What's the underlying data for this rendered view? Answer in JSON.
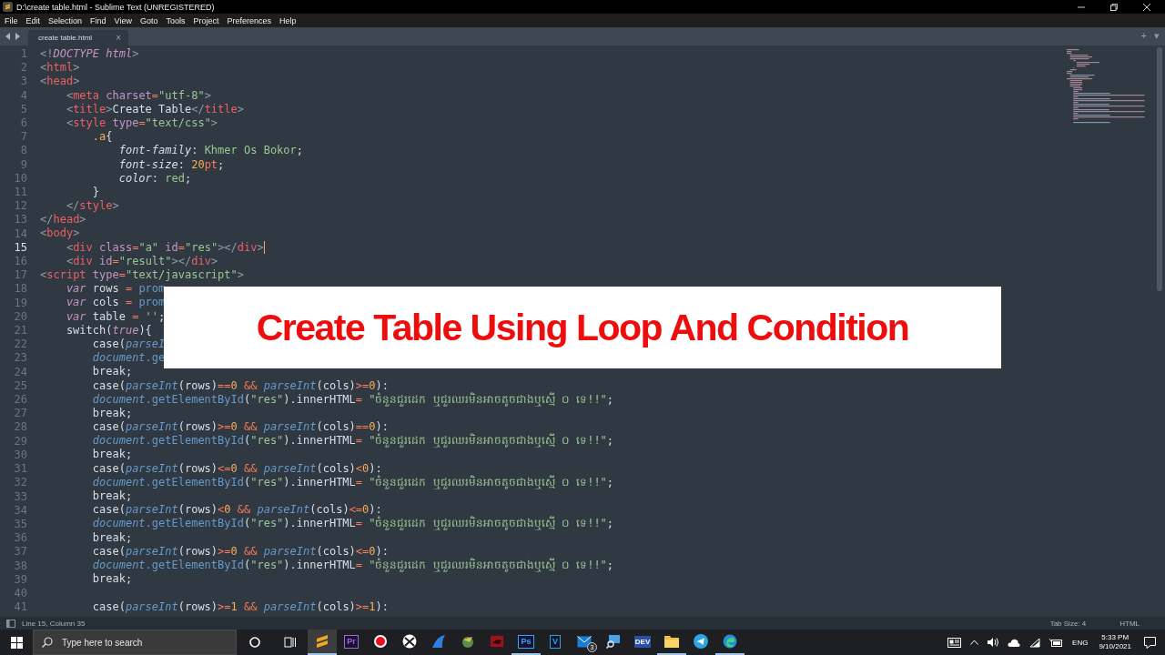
{
  "window": {
    "title": "D:\\create table.html - Sublime Text (UNREGISTERED)"
  },
  "menu": [
    "File",
    "Edit",
    "Selection",
    "Find",
    "View",
    "Goto",
    "Tools",
    "Project",
    "Preferences",
    "Help"
  ],
  "tabs": [
    {
      "label": "create table.html",
      "close": "×",
      "selected": true
    }
  ],
  "tab_bar_actions": {
    "new": "+",
    "list": "▾"
  },
  "editor": {
    "lines": [
      {
        "number": "1",
        "current": false,
        "tokens": [
          {
            "text": "<!",
            "kind": "pu"
          },
          {
            "text": "DOCTYPE html",
            "kind": "em"
          },
          {
            "text": ">",
            "kind": "pu"
          }
        ]
      },
      {
        "number": "2",
        "current": false,
        "tokens": [
          {
            "text": "<",
            "kind": "pu"
          },
          {
            "text": "html",
            "kind": "tag"
          },
          {
            "text": ">",
            "kind": "pu"
          }
        ]
      },
      {
        "number": "3",
        "current": false,
        "tokens": [
          {
            "text": "<",
            "kind": "pu"
          },
          {
            "text": "head",
            "kind": "tag"
          },
          {
            "text": ">",
            "kind": "pu"
          }
        ],
        "children": [
          {
            "number": "4",
            "current": false,
            "tokens": [
              {
                "text": "<",
                "kind": "pu"
              },
              {
                "text": "meta",
                "kind": "tag"
              },
              {
                "text": " charset",
                "kind": "attr"
              },
              {
                "text": "=",
                "kind": "op"
              },
              {
                "text": "\"utf-8\"",
                "kind": "str"
              },
              {
                "text": ">",
                "kind": "pu"
              }
            ]
          },
          {
            "number": "5",
            "current": false,
            "tokens": [
              {
                "text": "<",
                "kind": "pu"
              },
              {
                "text": "title",
                "kind": "tag"
              },
              {
                "text": ">",
                "kind": "pu"
              },
              {
                "text": "Create Table",
                "kind": "tx"
              },
              {
                "text": "</",
                "kind": "pu"
              },
              {
                "text": "title",
                "kind": "tag"
              },
              {
                "text": ">",
                "kind": "pu"
              }
            ]
          },
          {
            "number": "6",
            "current": false,
            "tokens": [
              {
                "text": "<",
                "kind": "pu"
              },
              {
                "text": "style",
                "kind": "tag"
              },
              {
                "text": " type",
                "kind": "attr"
              },
              {
                "text": "=",
                "kind": "op"
              },
              {
                "text": "\"text/css\"",
                "kind": "str"
              },
              {
                "text": ">",
                "kind": "pu"
              }
            ],
            "children": [
              {
                "number": "7",
                "current": false,
                "tokens": [
                  {
                    "text": ".a",
                    "kind": "cls"
                  },
                  {
                    "text": "{",
                    "kind": "tx"
                  }
                ],
                "children": [
                  {
                    "number": "8",
                    "current": false,
                    "tokens": [
                      {
                        "text": "font-family",
                        "kind": "prop"
                      },
                      {
                        "text": ":",
                        "kind": "tx"
                      },
                      {
                        "text": " Khmer Os Bokor",
                        "kind": "str"
                      },
                      {
                        "text": ";",
                        "kind": "tx"
                      }
                    ]
                  },
                  {
                    "number": "9",
                    "current": false,
                    "tokens": [
                      {
                        "text": "font-size",
                        "kind": "prop"
                      },
                      {
                        "text": ":",
                        "kind": "tx"
                      },
                      {
                        "text": " 20",
                        "kind": "num"
                      },
                      {
                        "text": "pt",
                        "kind": "op"
                      },
                      {
                        "text": ";",
                        "kind": "tx"
                      }
                    ]
                  },
                  {
                    "number": "10",
                    "current": false,
                    "tokens": [
                      {
                        "text": "color",
                        "kind": "prop"
                      },
                      {
                        "text": ":",
                        "kind": "tx"
                      },
                      {
                        "text": " red",
                        "kind": "str"
                      },
                      {
                        "text": ";",
                        "kind": "tx"
                      }
                    ]
                  }
                ]
              },
              {
                "number": "11",
                "current": false,
                "tokens": [
                  {
                    "text": "}",
                    "kind": "tx"
                  }
                ]
              }
            ]
          },
          {
            "number": "12",
            "current": false,
            "tokens": [
              {
                "text": "</",
                "kind": "pu"
              },
              {
                "text": "style",
                "kind": "tag"
              },
              {
                "text": ">",
                "kind": "pu"
              }
            ]
          }
        ]
      },
      {
        "number": "13",
        "current": false,
        "tokens": [
          {
            "text": "</",
            "kind": "pu"
          },
          {
            "text": "head",
            "kind": "tag"
          },
          {
            "text": ">",
            "kind": "pu"
          }
        ]
      },
      {
        "number": "14",
        "current": false,
        "tokens": [
          {
            "text": "<",
            "kind": "pu"
          },
          {
            "text": "body",
            "kind": "tag"
          },
          {
            "text": ">",
            "kind": "pu"
          }
        ],
        "children": [
          {
            "number": "15",
            "current": true,
            "tokens": [
              {
                "text": "<",
                "kind": "pu"
              },
              {
                "text": "div",
                "kind": "tag"
              },
              {
                "text": " class",
                "kind": "attr"
              },
              {
                "text": "=",
                "kind": "op"
              },
              {
                "text": "\"a\"",
                "kind": "str"
              },
              {
                "text": " id",
                "kind": "attr"
              },
              {
                "text": "=",
                "kind": "op"
              },
              {
                "text": "\"res\"",
                "kind": "str"
              },
              {
                "text": "></",
                "kind": "pu"
              },
              {
                "text": "div",
                "kind": "tag"
              },
              {
                "text": ">",
                "kind": "pu"
              }
            ]
          },
          {
            "number": "16",
            "current": false,
            "tokens": [
              {
                "text": "<",
                "kind": "pu"
              },
              {
                "text": "div",
                "kind": "tag"
              },
              {
                "text": " id",
                "kind": "attr"
              },
              {
                "text": "=",
                "kind": "op"
              },
              {
                "text": "\"result\"",
                "kind": "str"
              },
              {
                "text": "></",
                "kind": "pu"
              },
              {
                "text": "div",
                "kind": "tag"
              },
              {
                "text": ">",
                "kind": "pu"
              }
            ]
          }
        ]
      },
      {
        "number": "17",
        "current": false,
        "tokens": [
          {
            "text": "<",
            "kind": "pu"
          },
          {
            "text": "script",
            "kind": "tag"
          },
          {
            "text": " type",
            "kind": "attr"
          },
          {
            "text": "=",
            "kind": "op"
          },
          {
            "text": "\"text/javascript\"",
            "kind": "str"
          },
          {
            "text": ">",
            "kind": "pu"
          }
        ],
        "children": [
          {
            "number": "18",
            "current": false,
            "tokens": [
              {
                "text": "var",
                "kind": "kw"
              },
              {
                "text": " rows",
                "kind": "tx"
              },
              {
                "text": " =",
                "kind": "op"
              },
              {
                "text": " prom",
                "kind": "method"
              }
            ]
          },
          {
            "number": "19",
            "current": false,
            "tokens": [
              {
                "text": "var",
                "kind": "kw"
              },
              {
                "text": " cols",
                "kind": "tx"
              },
              {
                "text": " =",
                "kind": "op"
              },
              {
                "text": " prom",
                "kind": "method"
              }
            ]
          },
          {
            "number": "20",
            "current": false,
            "tokens": [
              {
                "text": "var",
                "kind": "kw"
              },
              {
                "text": " table",
                "kind": "tx"
              },
              {
                "text": " =",
                "kind": "op"
              },
              {
                "text": " ''",
                "kind": "str"
              },
              {
                "text": ";",
                "kind": "tx"
              }
            ]
          },
          {
            "number": "21",
            "current": false,
            "tokens": [
              {
                "text": "switch(",
                "kind": "tx"
              },
              {
                "text": "true",
                "kind": "kw"
              },
              {
                "text": "){",
                "kind": "tx"
              }
            ],
            "children": [
              {
                "number": "22",
                "current": false,
                "tokens": [
                  {
                    "text": "case(",
                    "kind": "tx"
                  },
                  {
                    "text": "parseI",
                    "kind": "fn"
                  }
                ]
              },
              {
                "number": "23",
                "current": false,
                "tokens": [
                  {
                    "text": "document",
                    "kind": "fn"
                  },
                  {
                    "text": ".ge",
                    "kind": "method"
                  }
                ]
              },
              {
                "number": "24",
                "current": false,
                "tokens": [
                  {
                    "text": "break;",
                    "kind": "tx"
                  }
                ]
              },
              {
                "number": "25",
                "current": false,
                "tokens": [
                  {
                    "text": "case(",
                    "kind": "tx"
                  },
                  {
                    "text": "parseInt",
                    "kind": "fn"
                  },
                  {
                    "text": "(rows)",
                    "kind": "tx"
                  },
                  {
                    "text": "==",
                    "kind": "op"
                  },
                  {
                    "text": "0",
                    "kind": "num"
                  },
                  {
                    "text": " &&",
                    "kind": "op"
                  },
                  {
                    "text": " parseInt",
                    "kind": "fn"
                  },
                  {
                    "text": "(cols)",
                    "kind": "tx"
                  },
                  {
                    "text": ">=",
                    "kind": "op"
                  },
                  {
                    "text": "0",
                    "kind": "num"
                  },
                  {
                    "text": "):",
                    "kind": "tx"
                  }
                ]
              },
              {
                "number": "26",
                "current": false,
                "tokens": [
                  {
                    "text": "document",
                    "kind": "fn"
                  },
                  {
                    "text": ".getElementById",
                    "kind": "method"
                  },
                  {
                    "text": "(",
                    "kind": "tx"
                  },
                  {
                    "text": "\"res\"",
                    "kind": "str"
                  },
                  {
                    "text": ").innerHTML",
                    "kind": "tx"
                  },
                  {
                    "text": "=",
                    "kind": "op"
                  },
                  {
                    "text": " \"ចំនួនជួរដេក ឬជួរឈរមិនអាចតូចជាងឬស្មើ ០ ទេ!!\"",
                    "kind": "str"
                  },
                  {
                    "text": ";",
                    "kind": "tx"
                  }
                ]
              },
              {
                "number": "27",
                "current": false,
                "tokens": [
                  {
                    "text": "break;",
                    "kind": "tx"
                  }
                ]
              },
              {
                "number": "28",
                "current": false,
                "tokens": [
                  {
                    "text": "case(",
                    "kind": "tx"
                  },
                  {
                    "text": "parseInt",
                    "kind": "fn"
                  },
                  {
                    "text": "(rows)",
                    "kind": "tx"
                  },
                  {
                    "text": ">=",
                    "kind": "op"
                  },
                  {
                    "text": "0",
                    "kind": "num"
                  },
                  {
                    "text": " &&",
                    "kind": "op"
                  },
                  {
                    "text": " parseInt",
                    "kind": "fn"
                  },
                  {
                    "text": "(cols)",
                    "kind": "tx"
                  },
                  {
                    "text": "==",
                    "kind": "op"
                  },
                  {
                    "text": "0",
                    "kind": "num"
                  },
                  {
                    "text": "):",
                    "kind": "tx"
                  }
                ]
              },
              {
                "number": "29",
                "current": false,
                "tokens": [
                  {
                    "text": "document",
                    "kind": "fn"
                  },
                  {
                    "text": ".getElementById",
                    "kind": "method"
                  },
                  {
                    "text": "(",
                    "kind": "tx"
                  },
                  {
                    "text": "\"res\"",
                    "kind": "str"
                  },
                  {
                    "text": ").innerHTML",
                    "kind": "tx"
                  },
                  {
                    "text": "=",
                    "kind": "op"
                  },
                  {
                    "text": " \"ចំនួនជួរដេក ឬជួរឈរមិនអាចតូចជាងឬស្មើ ០ ទេ!!\"",
                    "kind": "str"
                  },
                  {
                    "text": ";",
                    "kind": "tx"
                  }
                ]
              },
              {
                "number": "30",
                "current": false,
                "tokens": [
                  {
                    "text": "break;",
                    "kind": "tx"
                  }
                ]
              },
              {
                "number": "31",
                "current": false,
                "tokens": [
                  {
                    "text": "case(",
                    "kind": "tx"
                  },
                  {
                    "text": "parseInt",
                    "kind": "fn"
                  },
                  {
                    "text": "(rows)",
                    "kind": "tx"
                  },
                  {
                    "text": "<=",
                    "kind": "op"
                  },
                  {
                    "text": "0",
                    "kind": "num"
                  },
                  {
                    "text": " &&",
                    "kind": "op"
                  },
                  {
                    "text": " parseInt",
                    "kind": "fn"
                  },
                  {
                    "text": "(cols)",
                    "kind": "tx"
                  },
                  {
                    "text": "<",
                    "kind": "op"
                  },
                  {
                    "text": "0",
                    "kind": "num"
                  },
                  {
                    "text": "):",
                    "kind": "tx"
                  }
                ]
              },
              {
                "number": "32",
                "current": false,
                "tokens": [
                  {
                    "text": "document",
                    "kind": "fn"
                  },
                  {
                    "text": ".getElementById",
                    "kind": "method"
                  },
                  {
                    "text": "(",
                    "kind": "tx"
                  },
                  {
                    "text": "\"res\"",
                    "kind": "str"
                  },
                  {
                    "text": ").innerHTML",
                    "kind": "tx"
                  },
                  {
                    "text": "=",
                    "kind": "op"
                  },
                  {
                    "text": " \"ចំនួនជួរដេក ឬជួរឈរមិនអាចតូចជាងឬស្មើ ០ ទេ!!\"",
                    "kind": "str"
                  },
                  {
                    "text": ";",
                    "kind": "tx"
                  }
                ]
              },
              {
                "number": "33",
                "current": false,
                "tokens": [
                  {
                    "text": "break;",
                    "kind": "tx"
                  }
                ]
              },
              {
                "number": "34",
                "current": false,
                "tokens": [
                  {
                    "text": "case(",
                    "kind": "tx"
                  },
                  {
                    "text": "parseInt",
                    "kind": "fn"
                  },
                  {
                    "text": "(rows)",
                    "kind": "tx"
                  },
                  {
                    "text": "<",
                    "kind": "op"
                  },
                  {
                    "text": "0",
                    "kind": "num"
                  },
                  {
                    "text": " &&",
                    "kind": "op"
                  },
                  {
                    "text": " parseInt",
                    "kind": "fn"
                  },
                  {
                    "text": "(cols)",
                    "kind": "tx"
                  },
                  {
                    "text": "<=",
                    "kind": "op"
                  },
                  {
                    "text": "0",
                    "kind": "num"
                  },
                  {
                    "text": "):",
                    "kind": "tx"
                  }
                ]
              },
              {
                "number": "35",
                "current": false,
                "tokens": [
                  {
                    "text": "document",
                    "kind": "fn"
                  },
                  {
                    "text": ".getElementById",
                    "kind": "method"
                  },
                  {
                    "text": "(",
                    "kind": "tx"
                  },
                  {
                    "text": "\"res\"",
                    "kind": "str"
                  },
                  {
                    "text": ").innerHTML",
                    "kind": "tx"
                  },
                  {
                    "text": "=",
                    "kind": "op"
                  },
                  {
                    "text": " \"ចំនួនជួរដេក ឬជួរឈរមិនអាចតូចជាងឬស្មើ ០ ទេ!!\"",
                    "kind": "str"
                  },
                  {
                    "text": ";",
                    "kind": "tx"
                  }
                ]
              },
              {
                "number": "36",
                "current": false,
                "tokens": [
                  {
                    "text": "break;",
                    "kind": "tx"
                  }
                ]
              },
              {
                "number": "37",
                "current": false,
                "tokens": [
                  {
                    "text": "case(",
                    "kind": "tx"
                  },
                  {
                    "text": "parseInt",
                    "kind": "fn"
                  },
                  {
                    "text": "(rows)",
                    "kind": "tx"
                  },
                  {
                    "text": ">=",
                    "kind": "op"
                  },
                  {
                    "text": "0",
                    "kind": "num"
                  },
                  {
                    "text": " &&",
                    "kind": "op"
                  },
                  {
                    "text": " parseInt",
                    "kind": "fn"
                  },
                  {
                    "text": "(cols)",
                    "kind": "tx"
                  },
                  {
                    "text": "<=",
                    "kind": "op"
                  },
                  {
                    "text": "0",
                    "kind": "num"
                  },
                  {
                    "text": "):",
                    "kind": "tx"
                  }
                ]
              },
              {
                "number": "38",
                "current": false,
                "tokens": [
                  {
                    "text": "document",
                    "kind": "fn"
                  },
                  {
                    "text": ".getElementById",
                    "kind": "method"
                  },
                  {
                    "text": "(",
                    "kind": "tx"
                  },
                  {
                    "text": "\"res\"",
                    "kind": "str"
                  },
                  {
                    "text": ").innerHTML",
                    "kind": "tx"
                  },
                  {
                    "text": "=",
                    "kind": "op"
                  },
                  {
                    "text": " \"ចំនួនជួរដេក ឬជួរឈរមិនអាចតូចជាងឬស្មើ ០ ទេ!!\"",
                    "kind": "str"
                  },
                  {
                    "text": ";",
                    "kind": "tx"
                  }
                ]
              },
              {
                "number": "39",
                "current": false,
                "tokens": [
                  {
                    "text": "break;",
                    "kind": "tx"
                  }
                ]
              },
              {
                "number": "40",
                "current": false
              },
              {
                "number": "41",
                "current": false,
                "tokens": [
                  {
                    "text": "case(",
                    "kind": "tx"
                  },
                  {
                    "text": "parseInt",
                    "kind": "fn"
                  },
                  {
                    "text": "(rows)",
                    "kind": "tx"
                  },
                  {
                    "text": ">=",
                    "kind": "op"
                  },
                  {
                    "text": "1",
                    "kind": "num"
                  },
                  {
                    "text": " &&",
                    "kind": "op"
                  },
                  {
                    "text": " parseInt",
                    "kind": "fn"
                  },
                  {
                    "text": "(cols)",
                    "kind": "tx"
                  },
                  {
                    "text": ">=",
                    "kind": "op"
                  },
                  {
                    "text": "1",
                    "kind": "num"
                  },
                  {
                    "text": "):",
                    "kind": "tx"
                  }
                ]
              }
            ]
          }
        ]
      }
    ]
  },
  "overlay_banner": {
    "text": "Create Table Using Loop And Condition"
  },
  "status_bar": {
    "position": "Line 15, Column 35",
    "tab_size": "Tab Size: 4",
    "syntax": "HTML"
  },
  "taskbar": {
    "search": {
      "placeholder": "Type here to search"
    },
    "apps": [
      {
        "kind": "sublime",
        "selected": true,
        "open": true
      },
      {
        "kind": "tile",
        "label": "Pr",
        "color": "#9b6bd8",
        "selected": false,
        "open": false
      },
      {
        "kind": "record",
        "selected": false,
        "open": false
      },
      {
        "kind": "xbox",
        "selected": false,
        "open": false
      },
      {
        "kind": "fin",
        "selected": false,
        "open": false
      },
      {
        "kind": "globe",
        "selected": false,
        "open": false
      },
      {
        "kind": "red",
        "selected": false,
        "open": false
      },
      {
        "kind": "tile",
        "label": "Ps",
        "color": "#31a8ff",
        "selected": false,
        "open": true
      },
      {
        "kind": "tile",
        "label": "V",
        "color": "#2aa3d8",
        "selected": false,
        "open": false
      },
      {
        "kind": "mail",
        "badge": "3",
        "selected": false,
        "open": false
      },
      {
        "kind": "monitor",
        "selected": false,
        "open": false
      },
      {
        "kind": "dev",
        "label": "DEV",
        "selected": false,
        "open": false
      },
      {
        "kind": "folder",
        "selected": false,
        "open": true
      },
      {
        "kind": "telegram",
        "selected": false,
        "open": false
      },
      {
        "kind": "edge",
        "selected": false,
        "open": true
      }
    ],
    "tray": {
      "language": "ENG",
      "time": "5:33 PM",
      "date": "9/10/2021"
    }
  }
}
